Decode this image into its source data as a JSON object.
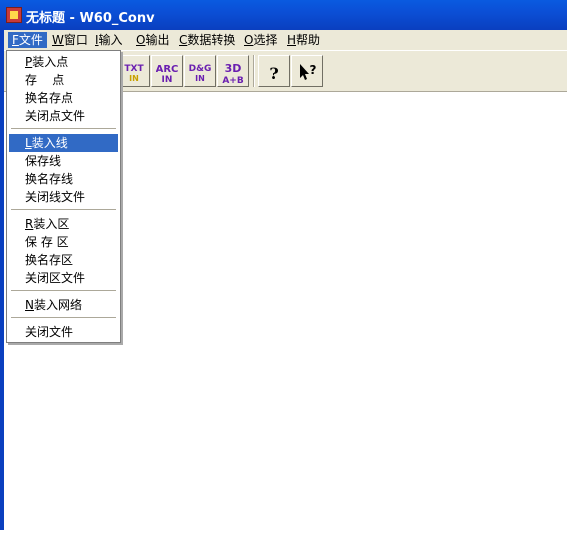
{
  "window": {
    "title": "无标题 - W60_Conv"
  },
  "menubar": [
    {
      "key": "F",
      "label": "文件",
      "active": true
    },
    {
      "key": "W",
      "label": "窗口",
      "active": false
    },
    {
      "key": "I",
      "label": "输入",
      "active": false
    },
    {
      "key": "O",
      "label": "输出",
      "active": false
    },
    {
      "key": "C",
      "label": "数据转换",
      "active": false
    },
    {
      "key": "O",
      "label": "选择",
      "active": false
    },
    {
      "key": "H",
      "label": "帮助",
      "active": false
    }
  ],
  "file_menu": {
    "items": [
      {
        "key": "P",
        "label": "装入点",
        "highlighted": false
      },
      {
        "key": "",
        "label": "存    点",
        "highlighted": false
      },
      {
        "key": "",
        "label": "换名存点",
        "highlighted": false
      },
      {
        "key": "",
        "label": "关闭点文件",
        "highlighted": false
      },
      {
        "key": "L",
        "label": "装入线",
        "highlighted": true
      },
      {
        "key": "",
        "label": "保存线",
        "highlighted": false
      },
      {
        "key": "",
        "label": "换名存线",
        "highlighted": false
      },
      {
        "key": "",
        "label": "关闭线文件",
        "highlighted": false
      },
      {
        "key": "R",
        "label": "装入区",
        "highlighted": false
      },
      {
        "key": "",
        "label": "保 存 区",
        "highlighted": false
      },
      {
        "key": "",
        "label": "换名存区",
        "highlighted": false
      },
      {
        "key": "",
        "label": "关闭区文件",
        "highlighted": false
      },
      {
        "key": "N",
        "label": "装入网络",
        "highlighted": false
      },
      {
        "key": "",
        "label": "关闭文件",
        "highlighted": false
      }
    ]
  },
  "toolbar": {
    "buttons": [
      {
        "name": "txt-in-button",
        "text": "TXT\nIN",
        "color": "#6a1fb0"
      },
      {
        "name": "arc-in-button",
        "text": "ARC\nIN",
        "color": "#6a1fb0"
      },
      {
        "name": "dcg-in-button",
        "text": "D&G\nIN",
        "color": "#6a1fb0"
      },
      {
        "name": "3d-a-b-button",
        "text": "3D\nA+B",
        "color": "#6a1fb0"
      },
      {
        "name": "help-button",
        "text": "?",
        "color": "#000000"
      },
      {
        "name": "context-help-button",
        "text": "?",
        "color": "#000000"
      }
    ]
  }
}
